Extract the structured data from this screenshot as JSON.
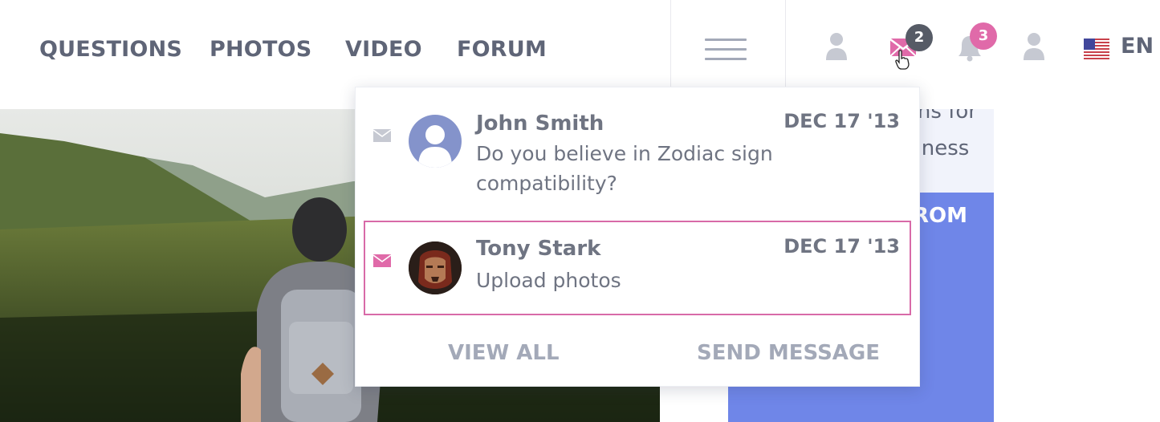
{
  "nav": {
    "links": [
      "QUESTIONS",
      "PHOTOS",
      "VIDEO",
      "FORUM"
    ]
  },
  "header_icons": {
    "profile": "user-icon",
    "messages": {
      "icon": "envelope-icon",
      "badge": "2",
      "badge_color": "#565b66",
      "accent": "#e06aa9"
    },
    "notifications": {
      "icon": "bell-icon",
      "badge": "3",
      "badge_color": "#e06aa9"
    },
    "account": "user-icon",
    "language": {
      "flag": "us-flag-icon",
      "code": "EN"
    }
  },
  "side_card": {
    "line1": "ons for",
    "line2": "siness",
    "cta": "ROM"
  },
  "messages_dropdown": {
    "items": [
      {
        "sender": "John Smith",
        "preview": "Do you believe in Zodiac sign compatibility?",
        "date": "DEC 17 '13",
        "avatar": "default-avatar",
        "active": false
      },
      {
        "sender": "Tony Stark",
        "preview": "Upload photos",
        "date": "DEC 17 '13",
        "avatar": "photo-avatar",
        "active": true
      }
    ],
    "view_all": "VIEW ALL",
    "send_message": "SEND MESSAGE"
  },
  "colors": {
    "accent_pink": "#e06aa9",
    "text_gray": "#6f7482",
    "muted_gray": "#a3a9b8",
    "card_blue": "#6f86e8"
  }
}
